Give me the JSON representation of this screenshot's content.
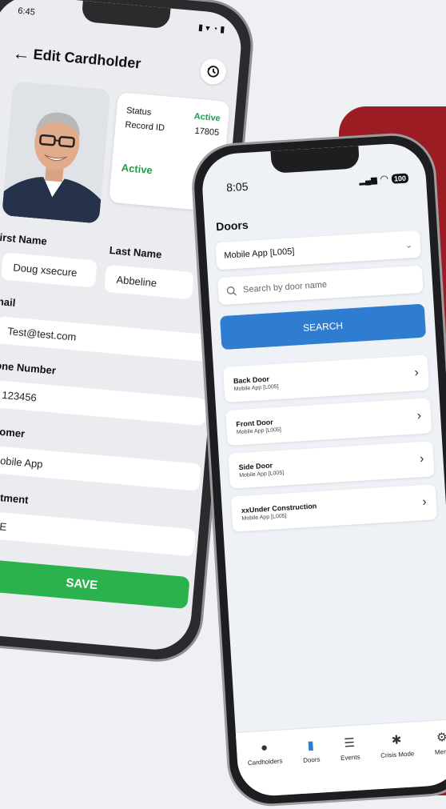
{
  "colors": {
    "brand_red": "#9c1c24",
    "active_green": "#2bb24c",
    "search_blue": "#2f7dd0"
  },
  "edit": {
    "status_time": "6:45",
    "title": "Edit Cardholder",
    "history_icon": "history-icon",
    "status_label": "Status",
    "status_value": "Active",
    "record_label": "Record ID",
    "record_value": "17805",
    "active_label": "Active",
    "first_name_label": "First Name",
    "first_name_value": "Doug xsecure",
    "last_name_label": "Last Name",
    "last_name_value": "Abbeline",
    "email_label": "Email",
    "email_value": "Test@test.com",
    "phone_label": "Phone Number",
    "phone_value": "123456",
    "customer_label": "Customer",
    "customer_value": "Mobile App",
    "department_label": "Department",
    "department_value": "EPE",
    "save_label": "SAVE"
  },
  "doors": {
    "status_time": "8:05",
    "battery": "100",
    "heading": "Doors",
    "dropdown_value": "Mobile App [L005]",
    "search_placeholder": "Search by door name",
    "search_button": "SEARCH",
    "items": [
      {
        "name": "Back Door",
        "sub": "Mobile App [L005]"
      },
      {
        "name": "Front Door",
        "sub": "Mobile App [L005]"
      },
      {
        "name": "Side Door",
        "sub": "Mobile App [L005]"
      },
      {
        "name": "xxUnder Construction",
        "sub": "Mobile App [L005]"
      }
    ],
    "tabs": [
      "Cardholders",
      "Doors",
      "Events",
      "Crisis Mode",
      "Menu"
    ]
  }
}
